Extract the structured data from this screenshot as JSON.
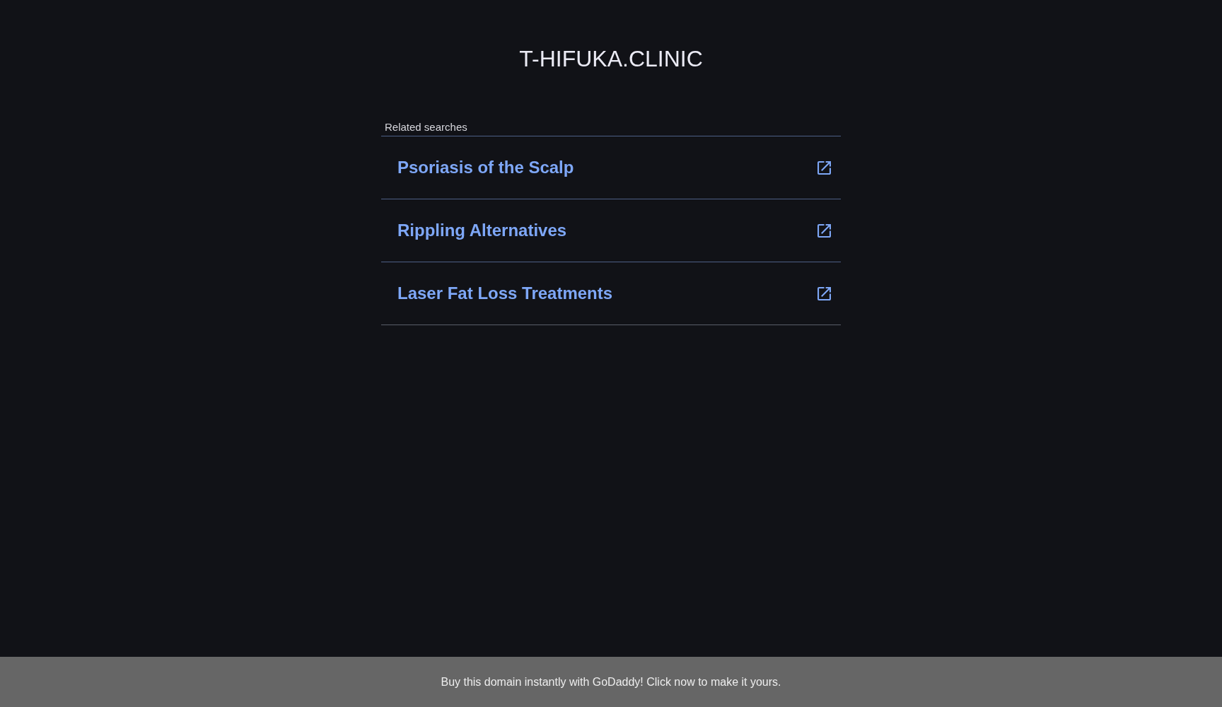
{
  "site_title": "T-HIFUKA.CLINIC",
  "related_searches": {
    "label": "Related searches",
    "items": [
      {
        "text": "Psoriasis of the Scalp"
      },
      {
        "text": "Rippling Alternatives"
      },
      {
        "text": "Laser Fat Loss Treatments"
      }
    ]
  },
  "footer_banner": {
    "text": "Buy this domain instantly with GoDaddy! Click now to make it yours."
  }
}
